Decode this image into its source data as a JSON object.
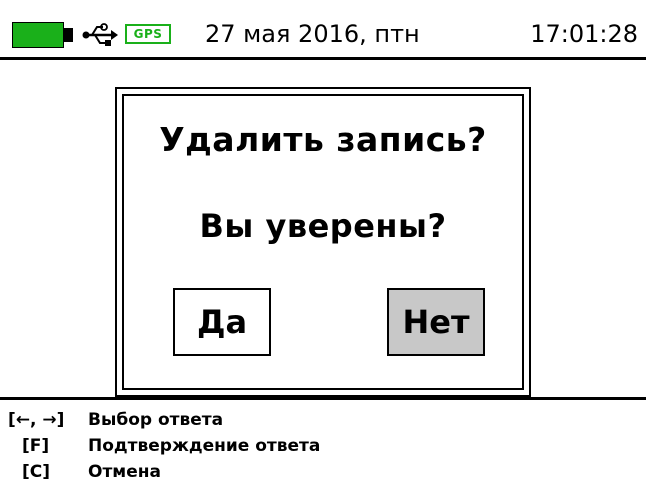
{
  "status_bar": {
    "battery_icon": "battery-icon",
    "usb_icon": "usb-icon",
    "gps_label": "GPS",
    "date": "27 мая 2016, птн",
    "time": "17:01:28"
  },
  "dialog": {
    "title": "Удалить запись?",
    "question": "Вы уверены?",
    "yes_label": "Да",
    "no_label": "Нет",
    "selected": "Нет"
  },
  "hints": [
    {
      "key": "[←, →]",
      "text": "Выбор ответа"
    },
    {
      "key": "[F]",
      "text": "Подтверждение ответа"
    },
    {
      "key": "[C]",
      "text": "Отмена"
    }
  ],
  "colors": {
    "battery": "#1ab01a",
    "gps": "#1ab01a",
    "selected_button": "#c8c8c8"
  }
}
